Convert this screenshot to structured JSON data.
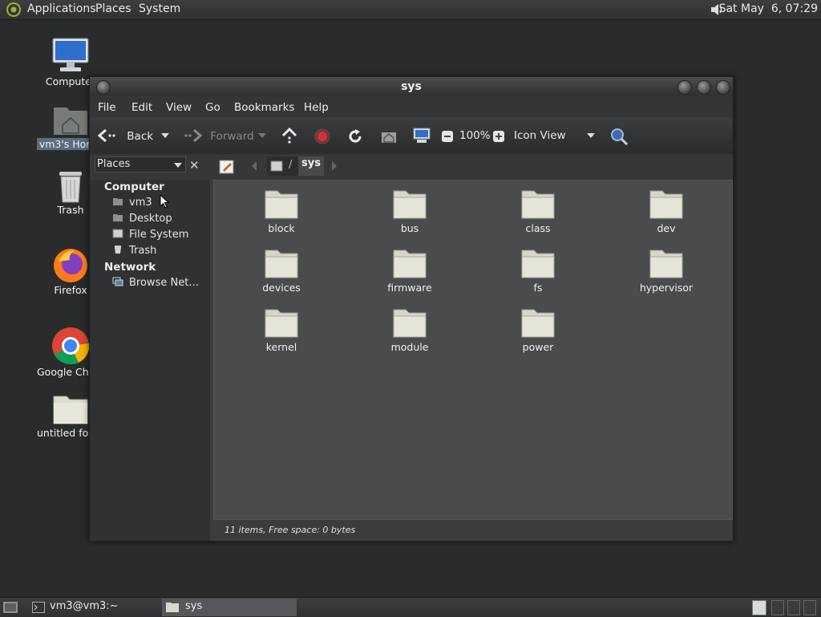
{
  "top_panel": {
    "menus": [
      "Applications",
      "Places",
      "System"
    ],
    "clock": "Sat May  6, 07:29",
    "volume_icon": "speaker-icon"
  },
  "desktop": {
    "icons": [
      {
        "label": "Computer",
        "icon": "computer-icon"
      },
      {
        "label": "vm3's Home",
        "icon": "home-folder-icon"
      },
      {
        "label": "Trash",
        "icon": "trash-icon"
      },
      {
        "label": "Firefox",
        "icon": "firefox-icon"
      },
      {
        "label": "Google Chrome",
        "icon": "chrome-icon"
      },
      {
        "label": "untitled folder",
        "icon": "folder-icon"
      }
    ]
  },
  "window": {
    "title": "sys",
    "menu": [
      "File",
      "Edit",
      "View",
      "Go",
      "Bookmarks",
      "Help"
    ],
    "toolbar": {
      "back": "Back",
      "forward": "Forward",
      "zoom": "100%",
      "view_mode": "Icon View"
    },
    "sidebar": {
      "selector": "Places",
      "sections": [
        {
          "title": "Computer",
          "items": [
            "vm3",
            "Desktop",
            "File System",
            "Trash"
          ]
        },
        {
          "title": "Network",
          "items": [
            "Browse Net…"
          ]
        }
      ]
    },
    "location": {
      "separator": "/",
      "current": "sys"
    },
    "files": [
      "block",
      "bus",
      "class",
      "dev",
      "devices",
      "firmware",
      "fs",
      "hypervisor",
      "kernel",
      "module",
      "power"
    ],
    "status": "11 items, Free space: 0 bytes"
  },
  "taskbar": {
    "tasks": [
      "vm3@vm3:~",
      "sys"
    ]
  }
}
